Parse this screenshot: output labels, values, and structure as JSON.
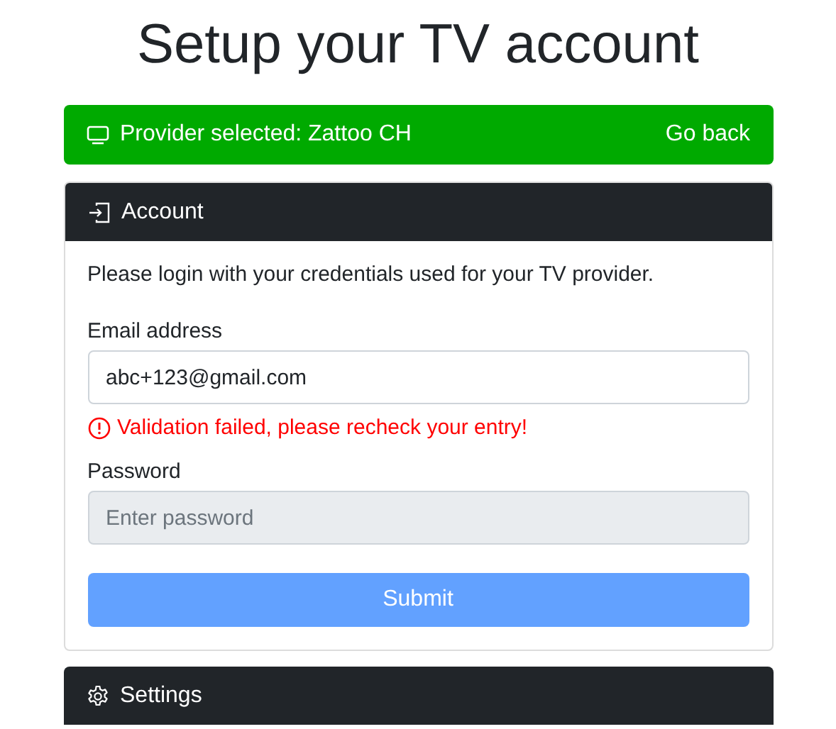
{
  "title": "Setup your TV account",
  "provider_bar": {
    "text": "Provider selected: Zattoo CH",
    "link": "Go back"
  },
  "account": {
    "header": "Account",
    "intro": "Please login with your credentials used for your TV provider.",
    "fields": [
      {
        "label": "Email address",
        "value": "abc+123@gmail.com",
        "disabled": false,
        "error": "Validation failed, please recheck your entry!"
      },
      {
        "label": "Password",
        "placeholder": "Enter password",
        "disabled": true
      }
    ],
    "submit": {
      "label": "Submit",
      "disabled": true
    }
  },
  "settings": {
    "header": "Settings"
  }
}
